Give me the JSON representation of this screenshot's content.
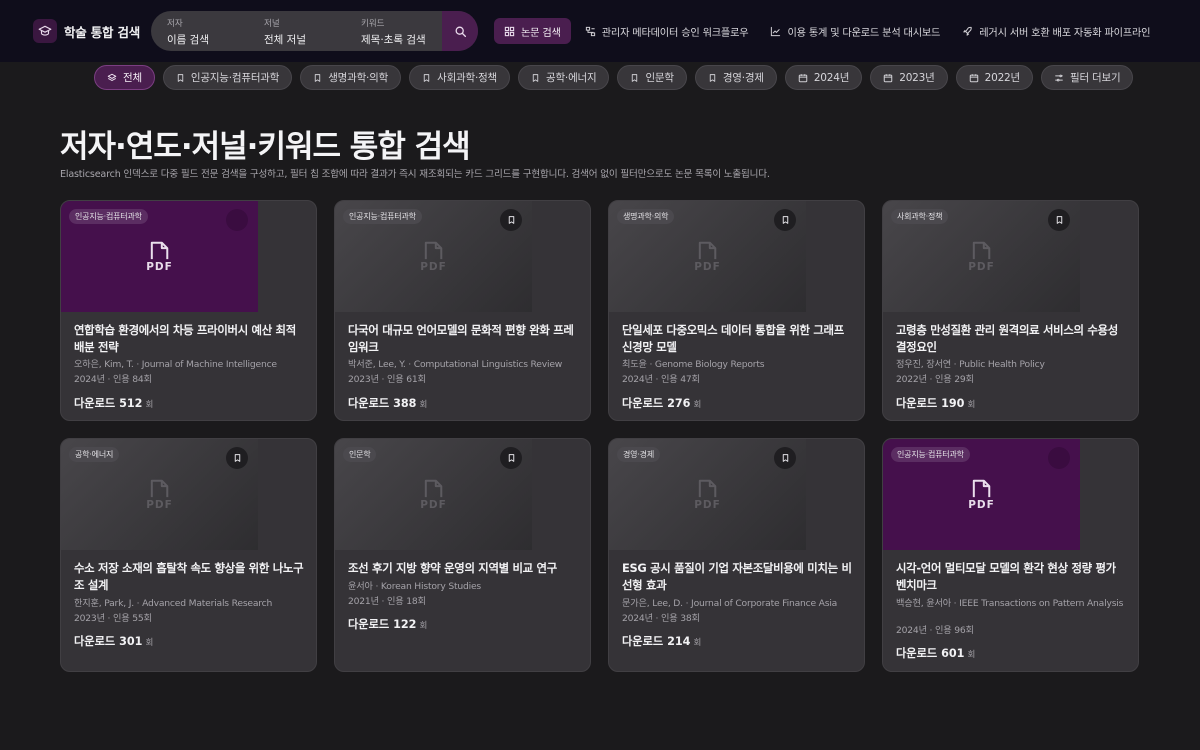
{
  "header": {
    "brand_title": "학술 통합 검색",
    "search": {
      "author_label": "저자",
      "author_value": "이름 검색",
      "journal_label": "저널",
      "journal_value": "전체 저널",
      "keyword_label": "키워드",
      "keyword_value": "제목·초록 검색"
    },
    "nav": [
      {
        "label": "논문 검색",
        "icon": "grid-icon",
        "active": true
      },
      {
        "label": "관리자 메타데이터 승인 워크플로우",
        "icon": "workflow-icon"
      },
      {
        "label": "이용 통계 및 다운로드 분석 대시보드",
        "icon": "chart-icon"
      },
      {
        "label": "레거시 서버 호환 배포 자동화 파이프라인",
        "icon": "rocket-icon"
      }
    ]
  },
  "filters": [
    {
      "label": "전체",
      "icon": "layers-icon",
      "active": true
    },
    {
      "label": "인공지능·컴퓨터과학",
      "icon": "bookmark-icon"
    },
    {
      "label": "생명과학·의학",
      "icon": "bookmark-icon"
    },
    {
      "label": "사회과학·정책",
      "icon": "bookmark-icon"
    },
    {
      "label": "공학·에너지",
      "icon": "bookmark-icon"
    },
    {
      "label": "인문학",
      "icon": "bookmark-icon"
    },
    {
      "label": "경영·경제",
      "icon": "bookmark-icon"
    },
    {
      "label": "2024년",
      "icon": "calendar-icon"
    },
    {
      "label": "2023년",
      "icon": "calendar-icon"
    },
    {
      "label": "2022년",
      "icon": "calendar-icon"
    },
    {
      "label": "필터 더보기",
      "icon": "sliders-icon"
    }
  ],
  "page": {
    "title": "저자·연도·저널·키워드 통합 검색",
    "description": "Elasticsearch 인덱스로 다중 필드 전문 검색을 구성하고, 필터 칩 조합에 따라 결과가 즉시 재조회되는 카드 그리드를 구현합니다. 검색어 없이 필터만으로도 논문 목록이 노출됩니다."
  },
  "thumb_label": "PDF",
  "download_label": "다운로드",
  "download_unit": "회",
  "papers": [
    {
      "category": "인공지능·컴퓨터과학",
      "title": "연합학습 환경에서의 차등 프라이버시 예산 최적 배분 전략",
      "authors": "오하은, Kim, T. · Journal of Machine Intelligence",
      "year_cite": "2024년 · 인용 84회",
      "downloads": "512",
      "highlight": true
    },
    {
      "category": "인공지능·컴퓨터과학",
      "title": "다국어 대규모 언어모델의 문화적 편향 완화 프레임워크",
      "authors": "박서준, Lee, Y. · Computational Linguistics Review",
      "year_cite": "2023년 · 인용 61회",
      "downloads": "388",
      "highlight": false
    },
    {
      "category": "생명과학·의학",
      "title": "단일세포 다중오믹스 데이터 통합을 위한 그래프 신경망 모델",
      "authors": "최도윤 · Genome Biology Reports",
      "year_cite": "2024년 · 인용 47회",
      "downloads": "276",
      "highlight": false
    },
    {
      "category": "사회과학·정책",
      "title": "고령층 만성질환 관리 원격의료 서비스의 수용성 결정요인",
      "authors": "정우진, 장서연 · Public Health Policy",
      "year_cite": "2022년 · 인용 29회",
      "downloads": "190",
      "highlight": false
    },
    {
      "category": "공학·에너지",
      "title": "수소 저장 소재의 흡탈착 속도 향상을 위한 나노구조 설계",
      "authors": "한지훈, Park, J. · Advanced Materials Research",
      "year_cite": "2023년 · 인용 55회",
      "downloads": "301",
      "highlight": false
    },
    {
      "category": "인문학",
      "title": "조선 후기 지방 향약 운영의 지역별 비교 연구",
      "authors": "윤서아 · Korean History Studies",
      "year_cite": "2021년 · 인용 18회",
      "downloads": "122",
      "highlight": false
    },
    {
      "category": "경영·경제",
      "title": "ESG 공시 품질이 기업 자본조달비용에 미치는 비선형 효과",
      "authors": "문가은, Lee, D. · Journal of Corporate Finance Asia",
      "year_cite": "2024년 · 인용 38회",
      "downloads": "214",
      "highlight": false
    },
    {
      "category": "인공지능·컴퓨터과학",
      "title": "시각-언어 멀티모달 모델의 환각 현상 정량 평가 벤치마크",
      "authors": "백승현, 윤서아 · IEEE Transactions on Pattern Analysis",
      "year_cite": "2024년 · 인용 96회",
      "downloads": "601",
      "highlight": true
    }
  ]
}
